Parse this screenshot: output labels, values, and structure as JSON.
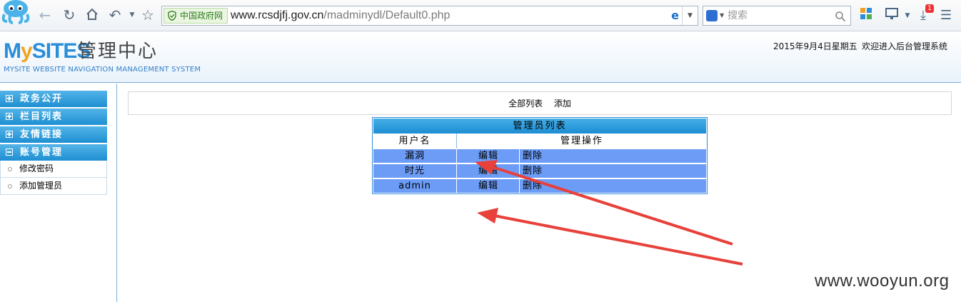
{
  "browser": {
    "gov_badge": "中国政府网",
    "url_host": "www.rcsdjfj.gov.cn",
    "url_path": "/madminydl/Default0.php",
    "search_placeholder": "搜索",
    "download_badge": "1",
    "ie_glyph": "e"
  },
  "header": {
    "brand_my": "M",
    "brand_y": "y",
    "brand_sites": "SITES",
    "brand_cn": "管理中心",
    "brand_sub": "MYSITE WEBSITE NAVIGATION MANAGEMENT SYSTEM",
    "date": "2015年9月4日星期五",
    "welcome": "欢迎进入后台管理系统"
  },
  "sidebar": {
    "groups": [
      {
        "label": "政务公开",
        "expanded": false
      },
      {
        "label": "栏目列表",
        "expanded": false
      },
      {
        "label": "友情链接",
        "expanded": false
      },
      {
        "label": "账号管理",
        "expanded": true
      }
    ],
    "sub_items": [
      {
        "label": "修改密码"
      },
      {
        "label": "添加管理员"
      }
    ]
  },
  "main": {
    "links": {
      "all_list": "全部列表",
      "add": "添加"
    },
    "table": {
      "title": "管理员列表",
      "headers": [
        "用户名",
        "管理操作"
      ],
      "rows": [
        {
          "username": "漏洞",
          "edit": "编辑",
          "delete": "删除"
        },
        {
          "username": "时光",
          "edit": "编辑",
          "delete": "删除"
        },
        {
          "username": "admin",
          "edit": "编辑",
          "delete": "删除"
        }
      ]
    }
  },
  "annotation_color": "#e8403a",
  "row_color": "#6c9cf6",
  "watermark": "www.wooyun.org"
}
